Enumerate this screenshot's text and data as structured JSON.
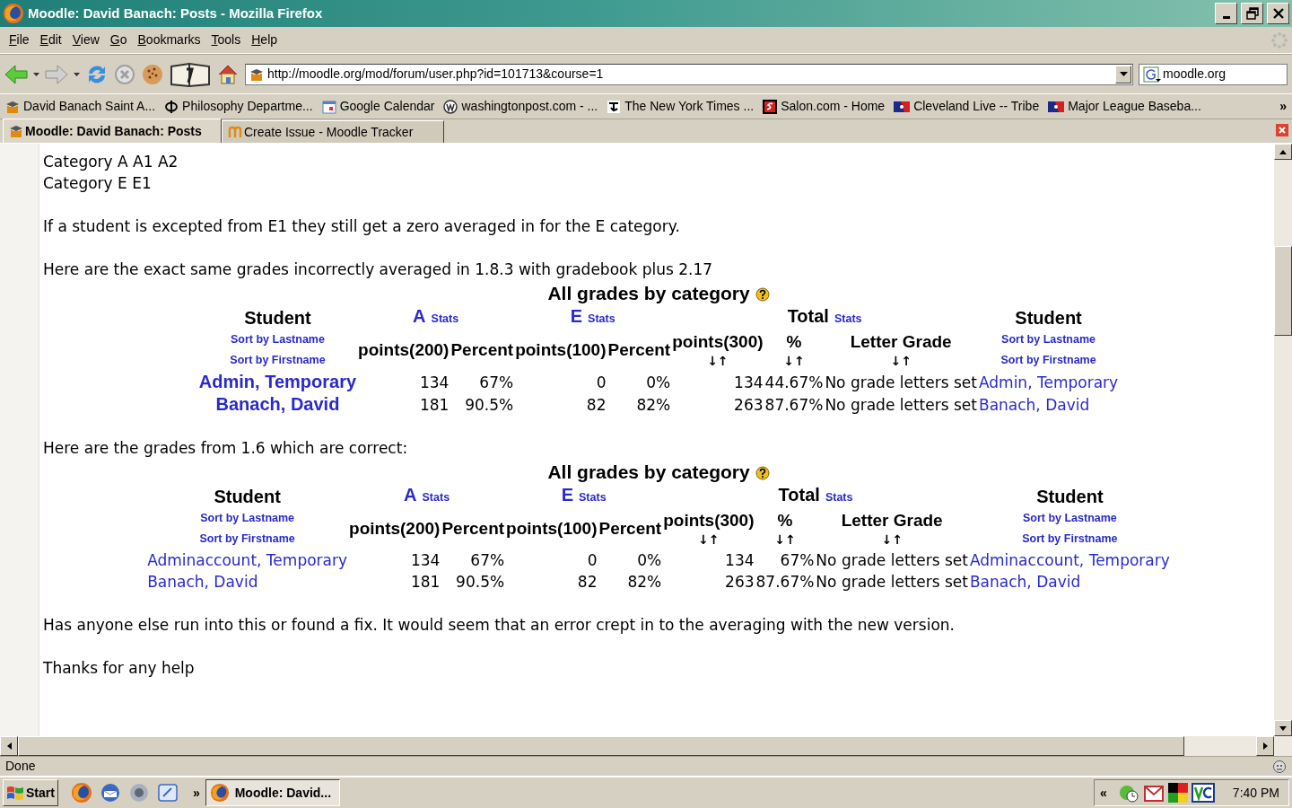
{
  "window": {
    "title": "Moodle: David Banach: Posts - Mozilla Firefox"
  },
  "menu": [
    {
      "label": "File"
    },
    {
      "label": "Edit"
    },
    {
      "label": "View"
    },
    {
      "label": "Go"
    },
    {
      "label": "Bookmarks"
    },
    {
      "label": "Tools"
    },
    {
      "label": "Help"
    }
  ],
  "toolbar": {
    "url": "http://moodle.org/mod/forum/user.php?id=101713&course=1",
    "search": "moodle.org"
  },
  "bookmarks": {
    "items": [
      {
        "label": "David Banach Saint A..."
      },
      {
        "label": "Philosophy Departme..."
      },
      {
        "label": "Google Calendar"
      },
      {
        "label": "washingtonpost.com - ..."
      },
      {
        "label": "The New York Times ..."
      },
      {
        "label": "Salon.com - Home"
      },
      {
        "label": "Cleveland Live -- Tribe"
      },
      {
        "label": "Major League Baseba..."
      }
    ],
    "more": "»"
  },
  "tabs": [
    {
      "label": "Moodle: David Banach: Posts",
      "selected": true
    },
    {
      "label": "Create Issue - Moodle Tracker",
      "selected": false
    }
  ],
  "content": [
    {
      "kind": "text",
      "lines": [
        "Category A A1 A2",
        "Category E E1"
      ]
    },
    {
      "kind": "text",
      "lines": [
        "If a student is excepted from E1 they still get a zero averaged in for the E category."
      ]
    },
    {
      "kind": "text",
      "lines": [
        "Here are the exact same grades incorrectly averaged in 1.8.3 with gradebook plus 2.17"
      ]
    },
    {
      "kind": "grades",
      "bold_names": true,
      "title": "All grades by category",
      "student_start": {
        "label": "Student",
        "sort_last": "Sort by Lastname",
        "sort_first": "Sort by Firstname"
      },
      "categories": [
        {
          "kind": "category",
          "name": "A",
          "stats": "Stats",
          "columns": [
            {
              "label": "points(200)"
            },
            {
              "label": "Percent"
            }
          ]
        },
        {
          "kind": "category",
          "name": "E",
          "stats": "Stats",
          "columns": [
            {
              "label": "points(100)"
            },
            {
              "label": "Percent"
            }
          ]
        },
        {
          "kind": "total",
          "name": "Total",
          "stats": "Stats",
          "columns": [
            {
              "label": "points(300)",
              "sort": "↓↑"
            },
            {
              "label": "%",
              "sort": "↓↑"
            },
            {
              "label": "Letter Grade",
              "sort": "↓↑"
            }
          ]
        }
      ],
      "student_end": {
        "label": "Student",
        "sort_last": "Sort by Lastname",
        "sort_first": "Sort by Firstname"
      },
      "rows": [
        {
          "student": "Admin, Temporary",
          "cells": [
            "134",
            "67%",
            "0",
            "0%",
            "134",
            "44.67%",
            "No grade letters set"
          ],
          "student_end": "Admin, Temporary"
        },
        {
          "student": "Banach, David",
          "cells": [
            "181",
            "90.5%",
            "82",
            "82%",
            "263",
            "87.67%",
            "No grade letters set"
          ],
          "student_end": "Banach, David"
        }
      ]
    },
    {
      "kind": "text",
      "lines": [
        "Here are the grades from 1.6 which are correct:"
      ]
    },
    {
      "kind": "grades",
      "bold_names": false,
      "title": "All grades by category",
      "student_start": {
        "label": "Student",
        "sort_last": "Sort by Lastname",
        "sort_first": "Sort by Firstname"
      },
      "categories": [
        {
          "kind": "category",
          "name": "A",
          "stats": "Stats",
          "columns": [
            {
              "label": "points(200)"
            },
            {
              "label": "Percent"
            }
          ]
        },
        {
          "kind": "category",
          "name": "E",
          "stats": "Stats",
          "columns": [
            {
              "label": "points(100)"
            },
            {
              "label": "Percent"
            }
          ]
        },
        {
          "kind": "total",
          "name": "Total",
          "stats": "Stats",
          "columns": [
            {
              "label": "points(300)",
              "sort": "↓↑"
            },
            {
              "label": "%",
              "sort": "↓↑"
            },
            {
              "label": "Letter Grade",
              "sort": "↓↑"
            }
          ]
        }
      ],
      "student_end": {
        "label": "Student",
        "sort_last": "Sort by Lastname",
        "sort_first": "Sort by Firstname"
      },
      "rows": [
        {
          "student": "Adminaccount, Temporary",
          "cells": [
            "134",
            "67%",
            "0",
            "0%",
            "134",
            "67%",
            "No grade letters set"
          ],
          "student_end": "Adminaccount, Temporary"
        },
        {
          "student": "Banach, David",
          "cells": [
            "181",
            "90.5%",
            "82",
            "82%",
            "263",
            "87.67%",
            "No grade letters set"
          ],
          "student_end": "Banach, David"
        }
      ]
    },
    {
      "kind": "text",
      "lines": [
        "Has anyone else run into this or found a fix. It would seem that an error crept in to the averaging with the new version."
      ]
    },
    {
      "kind": "text",
      "lines": [
        "Thanks for any help"
      ]
    }
  ],
  "status_bar": {
    "text": "Done"
  },
  "taskbar": {
    "start": "Start",
    "more": "»",
    "windows": [
      {
        "label": "Moodle: David...",
        "selected": true
      }
    ],
    "tray_more": "«",
    "clock": "7:40 PM"
  }
}
